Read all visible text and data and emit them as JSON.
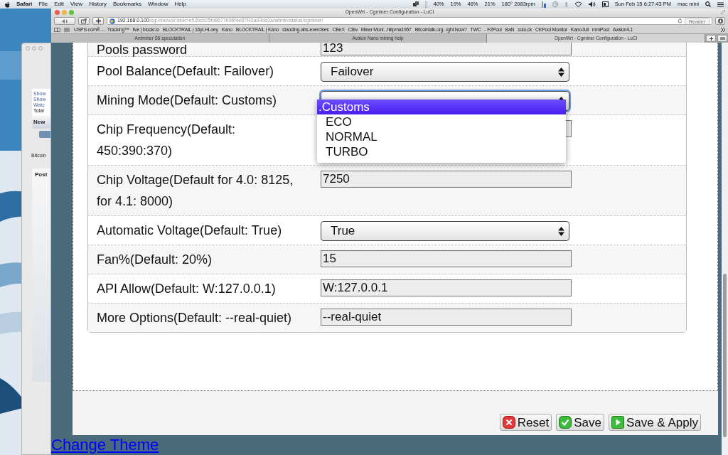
{
  "menubar": {
    "app": "Safari",
    "menus": [
      "File",
      "Edit",
      "View",
      "History",
      "Bookmarks",
      "Window",
      "Help"
    ],
    "status": [
      "40%",
      "19%",
      "46%",
      "21%",
      "180° 2083rpm"
    ],
    "clock": "Sun Feb 15  6:27:43 PM",
    "user": "mac mini"
  },
  "background_window": {
    "lines": [
      "Show",
      "Show",
      "Watc",
      "Total"
    ],
    "header": "New",
    "caption": "Bitcoin",
    "table_header": "Post"
  },
  "browser": {
    "title": "OpenWrt - Cgminer Configuration - LuCI",
    "url_host": "192.168.0.100",
    "url_path": "/cgi-bin/luci/;stok=e52bcb25fd8677b96f4e87f42a04dd2a/admin/status/cgminer/",
    "reader": "Reader",
    "bookmarks": [
      "USPS.com® -... Tracking™",
      "live | blockr.io",
      "BLOCKTRAIL | 16yLHLoey",
      "Kano",
      "BLOCKTRAIL | Kano",
      "standing-abs-exercises",
      "CBeX",
      "C8w",
      "Miner Moni...hilipma1957",
      "Bitcointalk.org...ight Now?",
      "TWC",
      "- F2Pool",
      "BaN",
      "solo.ck",
      "CKPool Monitor",
      "Kano-full",
      "mmPool",
      "Avalon4.1"
    ],
    "tabs": [
      {
        "label": "Antminer S6 speculation",
        "selected": false
      },
      {
        "label": "Avalon Nano mining help",
        "selected": false
      },
      {
        "label": "OpenWrt - Cgminer Configuration - LuCI",
        "selected": true
      }
    ]
  },
  "form": {
    "rows": [
      {
        "label": "Pools password",
        "kind": "text",
        "value": "123"
      },
      {
        "label": "Pool Balance(Default: Failover)",
        "kind": "select",
        "value": "Failover"
      },
      {
        "label": "Mining Mode(Default: Customs)",
        "kind": "select",
        "open": true,
        "options": [
          {
            "label": ".Customs",
            "selected": true
          },
          {
            "label": "ECO",
            "selected": false
          },
          {
            "label": "NORMAL",
            "selected": false
          },
          {
            "label": "TURBO",
            "selected": false
          }
        ]
      },
      {
        "label": "Chip Frequency(Default: 450:390:370)",
        "kind": "text"
      },
      {
        "label": "Chip Voltage(Default for 4.0: 8125, for 4.1: 8000)",
        "kind": "text",
        "value": "7250"
      },
      {
        "label": "Automatic Voltage(Default: True)",
        "kind": "select",
        "value": "True"
      },
      {
        "label": "Fan%(Default: 20%)",
        "kind": "text",
        "value": "15"
      },
      {
        "label": "API Allow(Default: W:127.0.0.1)",
        "kind": "text",
        "value": "W:127.0.0.1"
      },
      {
        "label": "More Options(Default: --real-quiet)",
        "kind": "text",
        "value": "--real-quiet"
      }
    ]
  },
  "buttons": [
    {
      "label": "Reset",
      "kind": "reset"
    },
    {
      "label": "Save",
      "kind": "save"
    },
    {
      "label": "Save & Apply",
      "kind": "apply"
    }
  ],
  "footer_link": "Change Theme"
}
